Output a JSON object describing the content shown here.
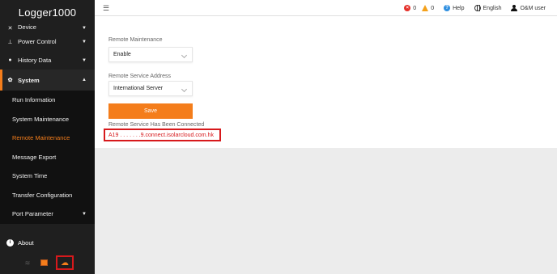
{
  "app": {
    "title": "Logger1000"
  },
  "topbar": {
    "fault_count": "0",
    "alarm_count": "0",
    "help_label": "Help",
    "language_label": "English",
    "user_label": "O&M user"
  },
  "sidebar": {
    "items": [
      {
        "label": "Device"
      },
      {
        "label": "Power Control"
      },
      {
        "label": "History Data"
      },
      {
        "label": "System"
      }
    ],
    "system_subitems": [
      {
        "label": "Run Information"
      },
      {
        "label": "System Maintenance"
      },
      {
        "label": "Remote Maintenance"
      },
      {
        "label": "Message Export"
      },
      {
        "label": "System Time"
      },
      {
        "label": "Transfer Configuration"
      },
      {
        "label": "Port Parameter"
      }
    ],
    "about_label": "About"
  },
  "main": {
    "remote_maintenance_label": "Remote Maintenance",
    "remote_maintenance_value": "Enable",
    "service_address_label": "Remote Service Address",
    "service_address_value": "International Server",
    "save_label": "Save",
    "status_text": "Remote Service Has Been Connected",
    "connected_address": "A19 . . . . . . .9.connect.isolarcloud.com.hk"
  },
  "colors": {
    "accent": "#f47d1b",
    "sidebar_bg": "#1f1f1f",
    "highlight_red": "#d7191c"
  },
  "icons": [
    "menu-icon",
    "fault-icon",
    "alarm-icon",
    "help-icon",
    "globe-icon",
    "user-icon",
    "wifi-icon",
    "network-icon",
    "cloud-icon"
  ]
}
